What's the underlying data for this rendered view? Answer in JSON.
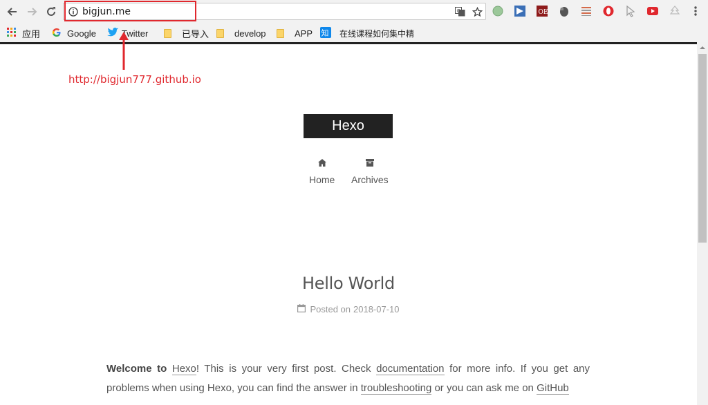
{
  "browser": {
    "url": "bigjun.me",
    "bookmarks": [
      {
        "label": "应用",
        "icon": "apps-grid-icon"
      },
      {
        "label": "Google",
        "icon": "google-icon"
      },
      {
        "label": "Twitter",
        "icon": "twitter-icon"
      },
      {
        "label": "已导入",
        "icon": "folder-icon"
      },
      {
        "label": "develop",
        "icon": "folder-icon"
      },
      {
        "label": "APP",
        "icon": "folder-icon"
      },
      {
        "label": "在线课程如何集中精",
        "icon": "zhihu-icon"
      }
    ]
  },
  "annotation": {
    "text": "http://bigjun777.github.io",
    "color": "#e0282e"
  },
  "site": {
    "title": "Hexo",
    "menu": [
      {
        "label": "Home",
        "icon": "home-icon"
      },
      {
        "label": "Archives",
        "icon": "archive-icon"
      }
    ]
  },
  "post": {
    "title": "Hello World",
    "meta_label": "Posted on",
    "date": "2018-07-10",
    "body": {
      "welcome": "Welcome to",
      "hexo_link": "Hexo",
      "text1": "! This is your very first post. Check",
      "docs_link": "documentation",
      "text2": "for more info. If you get any problems when using Hexo, you can find the answer in",
      "troubleshooting_link": "troubleshooting",
      "text3": "or you can ask me on",
      "github_link": "GitHub"
    }
  }
}
